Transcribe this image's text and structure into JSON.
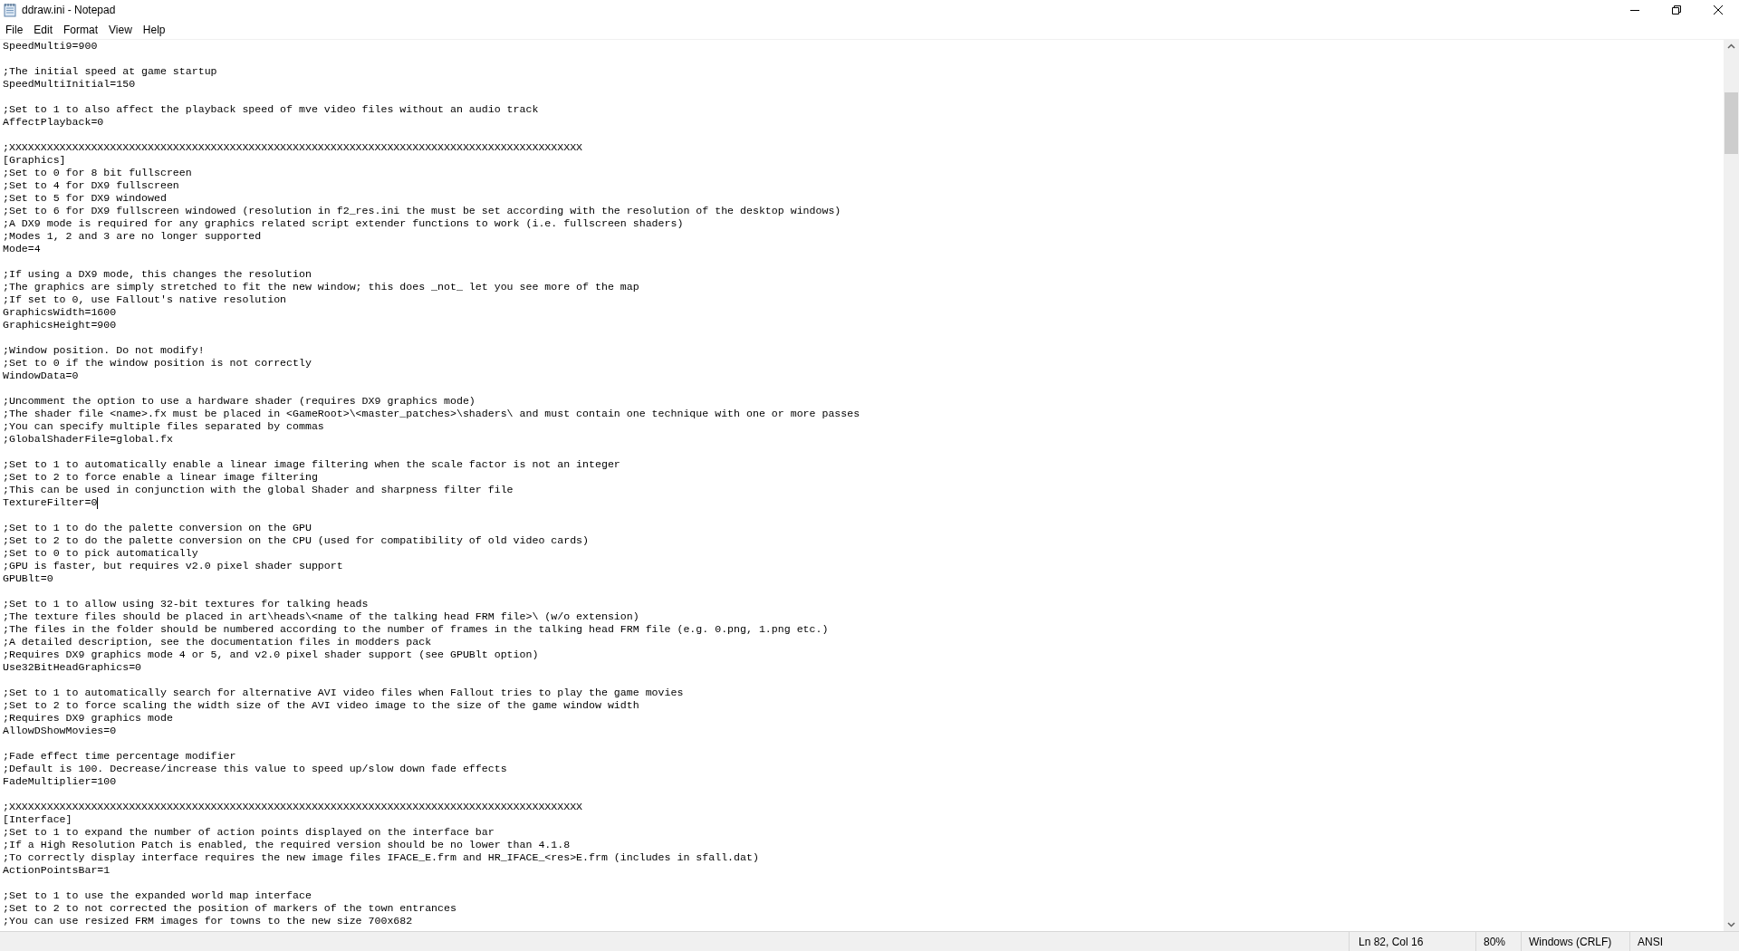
{
  "window": {
    "title": "ddraw.ini - Notepad"
  },
  "menu": [
    "File",
    "Edit",
    "Format",
    "View",
    "Help"
  ],
  "editor": {
    "blocks": [
      {
        "caret": false,
        "lines": [
          "SpeedMulti9=900"
        ]
      },
      {
        "caret": false,
        "lines": [
          ";The initial speed at game startup",
          "SpeedMultiInitial=150"
        ]
      },
      {
        "caret": false,
        "lines": [
          ";Set to 1 to also affect the playback speed of mve video files without an audio track",
          "AffectPlayback=0"
        ]
      },
      {
        "caret": false,
        "lines": [
          ";XXXXXXXXXXXXXXXXXXXXXXXXXXXXXXXXXXXXXXXXXXXXXXXXXXXXXXXXXXXXXXXXXXXXXXXXXXXXXXXXXXXXXXXXXXX",
          "[Graphics]",
          ";Set to 0 for 8 bit fullscreen",
          ";Set to 4 for DX9 fullscreen",
          ";Set to 5 for DX9 windowed",
          ";Set to 6 for DX9 fullscreen windowed (resolution in f2_res.ini the must be set according with the resolution of the desktop windows)",
          ";A DX9 mode is required for any graphics related script extender functions to work (i.e. fullscreen shaders)",
          ";Modes 1, 2 and 3 are no longer supported",
          "Mode=4"
        ]
      },
      {
        "caret": false,
        "lines": [
          ";If using a DX9 mode, this changes the resolution",
          ";The graphics are simply stretched to fit the new window; this does _not_ let you see more of the map",
          ";If set to 0, use Fallout's native resolution",
          "GraphicsWidth=1600",
          "GraphicsHeight=900"
        ]
      },
      {
        "caret": false,
        "lines": [
          ";Window position. Do not modify!",
          ";Set to 0 if the window position is not correctly",
          "WindowData=0"
        ]
      },
      {
        "caret": false,
        "lines": [
          ";Uncomment the option to use a hardware shader (requires DX9 graphics mode)",
          ";The shader file <name>.fx must be placed in <GameRoot>\\<master_patches>\\shaders\\ and must contain one technique with one or more passes",
          ";You can specify multiple files separated by commas",
          ";GlobalShaderFile=global.fx"
        ]
      },
      {
        "caret": true,
        "lines": [
          ";Set to 1 to automatically enable a linear image filtering when the scale factor is not an integer",
          ";Set to 2 to force enable a linear image filtering",
          ";This can be used in conjunction with the global Shader and sharpness filter file",
          "TextureFilter=0"
        ]
      },
      {
        "caret": false,
        "lines": [
          ";Set to 1 to do the palette conversion on the GPU",
          ";Set to 2 to do the palette conversion on the CPU (used for compatibility of old video cards)",
          ";Set to 0 to pick automatically",
          ";GPU is faster, but requires v2.0 pixel shader support",
          "GPUBlt=0"
        ]
      },
      {
        "caret": false,
        "lines": [
          ";Set to 1 to allow using 32-bit textures for talking heads",
          ";The texture files should be placed in art\\heads\\<name of the talking head FRM file>\\ (w/o extension)",
          ";The files in the folder should be numbered according to the number of frames in the talking head FRM file (e.g. 0.png, 1.png etc.)",
          ";A detailed description, see the documentation files in modders pack",
          ";Requires DX9 graphics mode 4 or 5, and v2.0 pixel shader support (see GPUBlt option)",
          "Use32BitHeadGraphics=0"
        ]
      },
      {
        "caret": false,
        "lines": [
          ";Set to 1 to automatically search for alternative AVI video files when Fallout tries to play the game movies",
          ";Set to 2 to force scaling the width size of the AVI video image to the size of the game window width",
          ";Requires DX9 graphics mode",
          "AllowDShowMovies=0"
        ]
      },
      {
        "caret": false,
        "lines": [
          ";Fade effect time percentage modifier",
          ";Default is 100. Decrease/increase this value to speed up/slow down fade effects",
          "FadeMultiplier=100"
        ]
      },
      {
        "caret": false,
        "lines": [
          ";XXXXXXXXXXXXXXXXXXXXXXXXXXXXXXXXXXXXXXXXXXXXXXXXXXXXXXXXXXXXXXXXXXXXXXXXXXXXXXXXXXXXXXXXXXX",
          "[Interface]",
          ";Set to 1 to expand the number of action points displayed on the interface bar",
          ";If a High Resolution Patch is enabled, the required version should be no lower than 4.1.8",
          ";To correctly display interface requires the new image files IFACE_E.frm and HR_IFACE_<res>E.frm (includes in sfall.dat)",
          "ActionPointsBar=1"
        ]
      },
      {
        "caret": false,
        "lines": [
          ";Set to 1 to use the expanded world map interface",
          ";Set to 2 to not corrected the position of markers of the town entrances",
          ";You can use resized FRM images for towns to the new size 700x682"
        ]
      }
    ]
  },
  "status_bar": {
    "position": "Ln 82, Col 16",
    "zoom": "80%",
    "line_endings": "Windows (CRLF)",
    "encoding": "ANSI"
  }
}
